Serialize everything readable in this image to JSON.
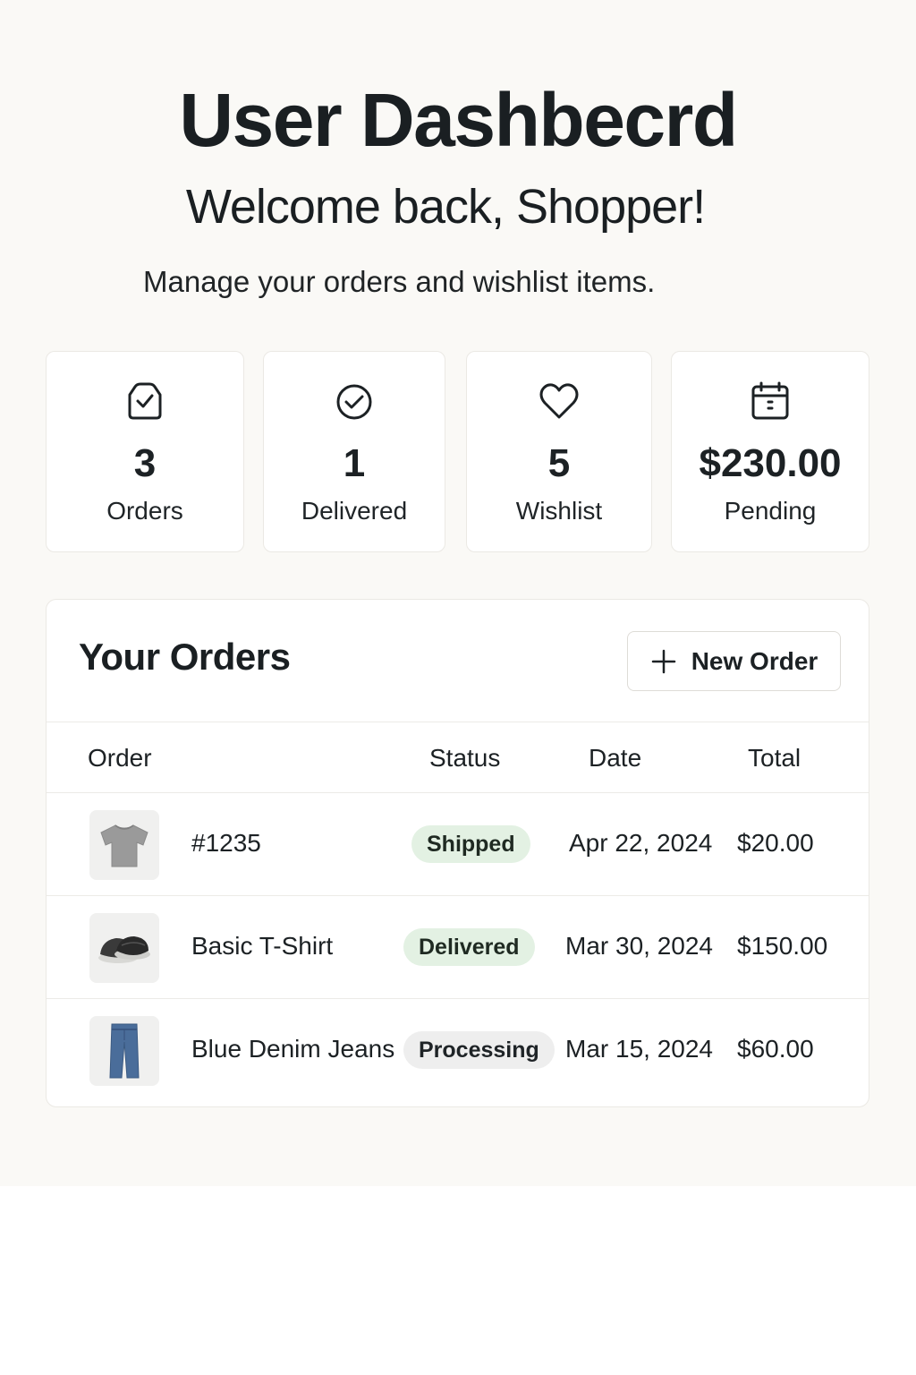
{
  "header": {
    "title": "User Dashbecrd",
    "welcome": "Welcome back, Shopper!",
    "subtitle": "Manage your orders and wishlist items."
  },
  "stats": [
    {
      "icon": "shopping-bag-check-icon",
      "value": "3",
      "label": "Orders"
    },
    {
      "icon": "check-circle-icon",
      "value": "1",
      "label": "Delivered"
    },
    {
      "icon": "heart-icon",
      "value": "5",
      "label": "Wishlist"
    },
    {
      "icon": "calendar-icon",
      "value": "$230.00",
      "label": "Pending"
    }
  ],
  "orders": {
    "title": "Your Orders",
    "new_order_label": "New Order",
    "columns": [
      "Order",
      "Status",
      "Date",
      "Total"
    ],
    "rows": [
      {
        "thumb": "t-shirt-thumbnail",
        "name": "#1235",
        "status": "Shipped",
        "status_color": "#e3f1e3",
        "date": "Apr 22, 2024",
        "total": "$20.00"
      },
      {
        "thumb": "slippers-thumbnail",
        "name": "Basic T-Shirt",
        "status": "Delivered",
        "status_color": "#e3f1e3",
        "date": "Mar 30, 2024",
        "total": "$150.00"
      },
      {
        "thumb": "jeans-thumbnail",
        "name": "Blue Denim Jeans",
        "status": "Processing",
        "status_color": "#eeeeee",
        "date": "Mar 15, 2024",
        "total": "$60.00"
      }
    ]
  }
}
